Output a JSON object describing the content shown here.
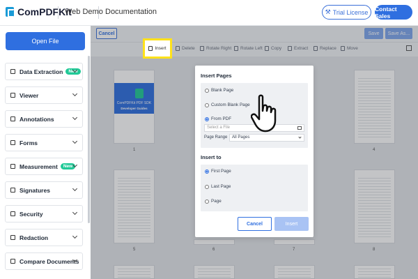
{
  "header": {
    "brand": "ComPDFKit",
    "nav": [
      "Web Demo",
      "Documentation"
    ],
    "trial_label": "Trial License",
    "contact_label": "Contact Sales"
  },
  "sidebar": {
    "open_file_label": "Open File",
    "items": [
      {
        "label": "Data Extraction",
        "badge": "New"
      },
      {
        "label": "Viewer"
      },
      {
        "label": "Annotations"
      },
      {
        "label": "Forms"
      },
      {
        "label": "Measurement",
        "badge": "New"
      },
      {
        "label": "Signatures"
      },
      {
        "label": "Security"
      },
      {
        "label": "Redaction"
      },
      {
        "label": "Compare Documents"
      }
    ]
  },
  "toolbar": {
    "cancel_label": "Cancel",
    "save_label": "Save",
    "save_as_label": "Save As...",
    "tools": [
      "Insert",
      "Delete",
      "Rotate Right",
      "Rotate Left",
      "Copy",
      "Extract",
      "Replace",
      "Move"
    ]
  },
  "thumbnails": {
    "labels": [
      "1",
      "4",
      "5",
      "6",
      "7",
      "8"
    ],
    "cover_title": "ComPDFKit PDF SDK",
    "cover_subtitle": "Developer Guides"
  },
  "dialog": {
    "insert_pages_title": "Insert Pages",
    "page_options": [
      "Blank Page",
      "Custom Blank Page",
      "From PDF"
    ],
    "selected_page_option": "From PDF",
    "file_placeholder": "Select a File",
    "page_range_label": "Page Range",
    "page_range_value": "All Pages",
    "insert_to_title": "Insert to",
    "insert_to_options": [
      "First Page",
      "Last Page",
      "Page"
    ],
    "selected_insert_to": "First Page",
    "cancel_label": "Cancel",
    "insert_label": "Insert"
  },
  "colors": {
    "accent": "#2f6fe0",
    "highlight": "#ffe21a",
    "badge": "#20c997"
  }
}
